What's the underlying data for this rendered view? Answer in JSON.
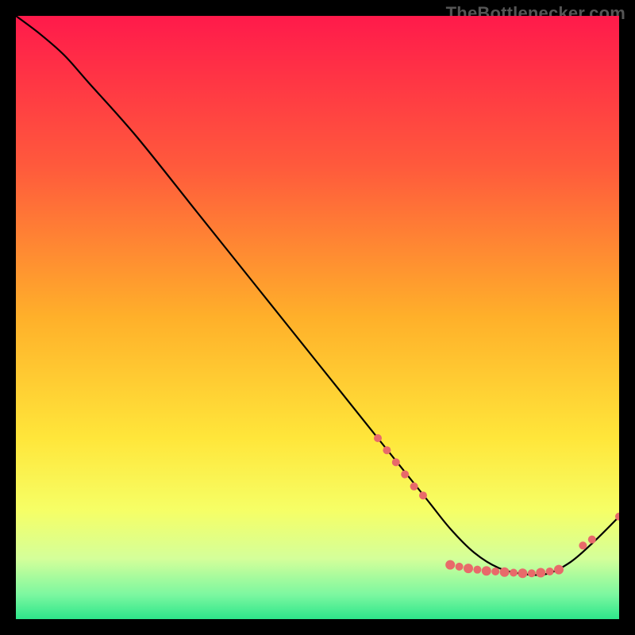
{
  "watermark": "TheBottlenecker.com",
  "chart_data": {
    "type": "line",
    "title": "",
    "xlabel": "",
    "ylabel": "",
    "xlim": [
      0,
      100
    ],
    "ylim": [
      0,
      100
    ],
    "gradient_stops": [
      {
        "offset": 0,
        "color": "#ff1a4b"
      },
      {
        "offset": 25,
        "color": "#ff5a3c"
      },
      {
        "offset": 50,
        "color": "#ffb02a"
      },
      {
        "offset": 70,
        "color": "#ffe63a"
      },
      {
        "offset": 82,
        "color": "#f6ff66"
      },
      {
        "offset": 90,
        "color": "#d4ff9a"
      },
      {
        "offset": 96,
        "color": "#7bf7a0"
      },
      {
        "offset": 100,
        "color": "#2de68a"
      }
    ],
    "series": [
      {
        "name": "curve",
        "color": "#000000",
        "x": [
          0,
          4,
          8,
          12,
          20,
          30,
          40,
          50,
          60,
          68,
          72,
          76,
          80,
          84,
          88,
          92,
          96,
          100
        ],
        "y": [
          100,
          97,
          93.5,
          89,
          80,
          67.5,
          55,
          42.5,
          30,
          20,
          15,
          11,
          8.5,
          7.5,
          7.5,
          9.5,
          13,
          17
        ]
      }
    ],
    "markers": {
      "color": "#e86a6a",
      "points": [
        {
          "x": 60,
          "y": 30,
          "r": 5
        },
        {
          "x": 61.5,
          "y": 28,
          "r": 5
        },
        {
          "x": 63,
          "y": 26,
          "r": 5
        },
        {
          "x": 64.5,
          "y": 24,
          "r": 5
        },
        {
          "x": 66,
          "y": 22,
          "r": 5
        },
        {
          "x": 67.5,
          "y": 20.5,
          "r": 5
        },
        {
          "x": 72,
          "y": 9,
          "r": 6
        },
        {
          "x": 73.5,
          "y": 8.7,
          "r": 5
        },
        {
          "x": 75,
          "y": 8.4,
          "r": 6
        },
        {
          "x": 76.5,
          "y": 8.2,
          "r": 5
        },
        {
          "x": 78,
          "y": 8,
          "r": 6
        },
        {
          "x": 79.5,
          "y": 7.9,
          "r": 5
        },
        {
          "x": 81,
          "y": 7.8,
          "r": 6
        },
        {
          "x": 82.5,
          "y": 7.7,
          "r": 5
        },
        {
          "x": 84,
          "y": 7.6,
          "r": 6
        },
        {
          "x": 85.5,
          "y": 7.6,
          "r": 5
        },
        {
          "x": 87,
          "y": 7.7,
          "r": 6
        },
        {
          "x": 88.5,
          "y": 7.9,
          "r": 5
        },
        {
          "x": 90,
          "y": 8.2,
          "r": 6
        },
        {
          "x": 94,
          "y": 12.2,
          "r": 5
        },
        {
          "x": 95.5,
          "y": 13.2,
          "r": 5
        },
        {
          "x": 100,
          "y": 17,
          "r": 5
        }
      ]
    }
  }
}
